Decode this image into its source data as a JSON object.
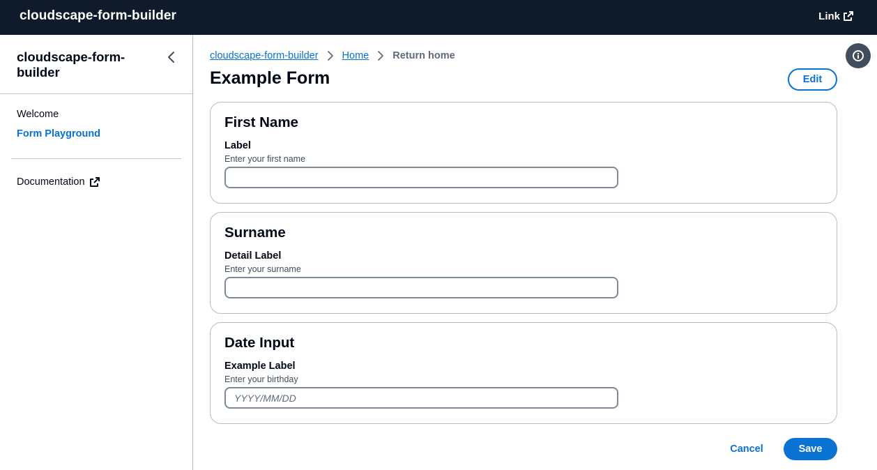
{
  "topnav": {
    "title": "cloudscape-form-builder",
    "link_label": "Link",
    "link_icon": "external-link-icon"
  },
  "sidenav": {
    "header": "cloudscape-form-builder",
    "collapse_icon": "chevron-left-icon",
    "items": [
      {
        "label": "Welcome",
        "active": false
      },
      {
        "label": "Form Playground",
        "active": true
      }
    ],
    "external": {
      "label": "Documentation",
      "icon": "external-link-icon"
    }
  },
  "breadcrumb": {
    "items": [
      "cloudscape-form-builder",
      "Home"
    ],
    "current": "Return home"
  },
  "page": {
    "title": "Example Form",
    "edit_label": "Edit",
    "info_icon": "info-icon"
  },
  "cards": [
    {
      "title": "First Name",
      "label": "Label",
      "description": "Enter your first name",
      "value": "",
      "placeholder": ""
    },
    {
      "title": "Surname",
      "label": "Detail Label",
      "description": "Enter your surname",
      "value": "",
      "placeholder": ""
    },
    {
      "title": "Date Input",
      "label": "Example Label",
      "description": "Enter your birthday",
      "value": "",
      "placeholder": "YYYY/MM/DD"
    }
  ],
  "actions": {
    "cancel_label": "Cancel",
    "save_label": "Save"
  },
  "colors": {
    "topnav_bg": "#0f1b2a",
    "accent": "#0972d3",
    "text": "#000716",
    "border": "#b6bec9"
  }
}
